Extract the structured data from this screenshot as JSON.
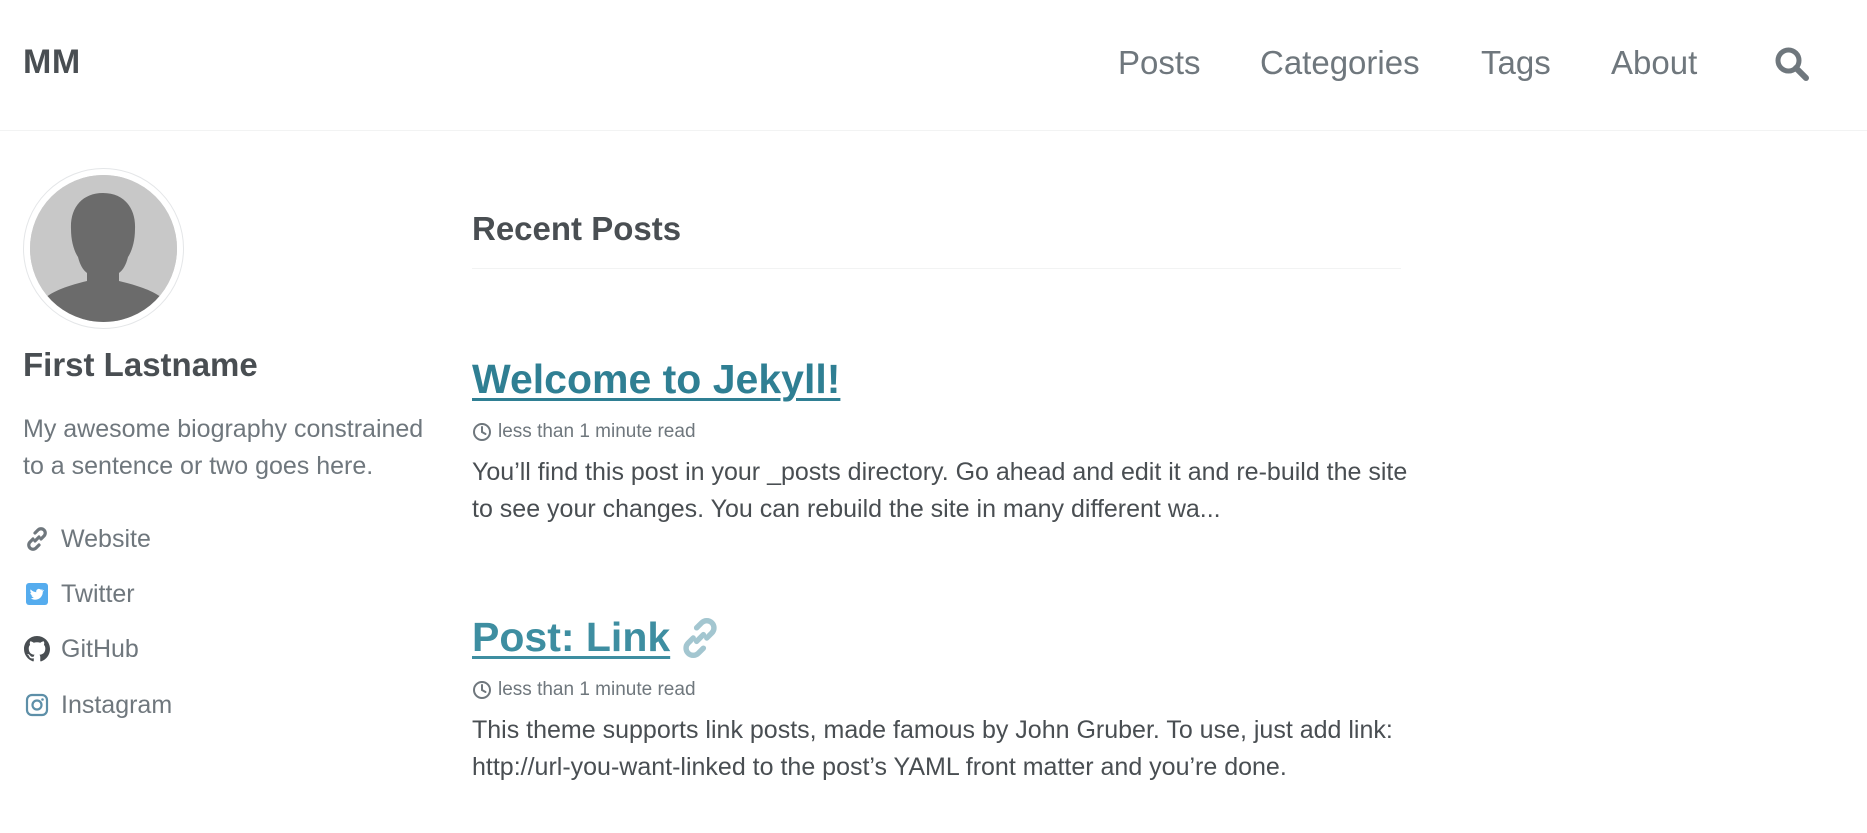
{
  "masthead": {
    "site_title": "MM",
    "nav": [
      {
        "label": "Posts"
      },
      {
        "label": "Categories"
      },
      {
        "label": "Tags"
      },
      {
        "label": "About"
      }
    ],
    "search_icon": "search-icon"
  },
  "author": {
    "avatar_icon": "avatar-placeholder-icon",
    "name": "First Lastname",
    "bio": "My awesome biography constrained to a sentence or two goes here.",
    "links": [
      {
        "label": "Website",
        "icon": "link-icon"
      },
      {
        "label": "Twitter",
        "icon": "twitter-icon"
      },
      {
        "label": "GitHub",
        "icon": "github-icon"
      },
      {
        "label": "Instagram",
        "icon": "instagram-icon"
      }
    ]
  },
  "main": {
    "section_title": "Recent Posts",
    "posts": [
      {
        "title": "Welcome to Jekyll!",
        "read_time": "less than 1 minute read",
        "excerpt": "You’ll find this post in your _posts directory. Go ahead and edit it and re-build the site to see your changes. You can rebuild the site in many different wa..."
      },
      {
        "title": "Post: Link ",
        "read_time": "less than 1 minute read",
        "excerpt": "This theme supports link posts, made famous by John Gruber. To use, just add link: http://url-you-want-linked to the post’s YAML front matter and you’re done."
      }
    ]
  },
  "colors": {
    "link": "#2f7f93",
    "text": "#494e52",
    "muted": "#6f777d",
    "twitter": "#55acee"
  }
}
